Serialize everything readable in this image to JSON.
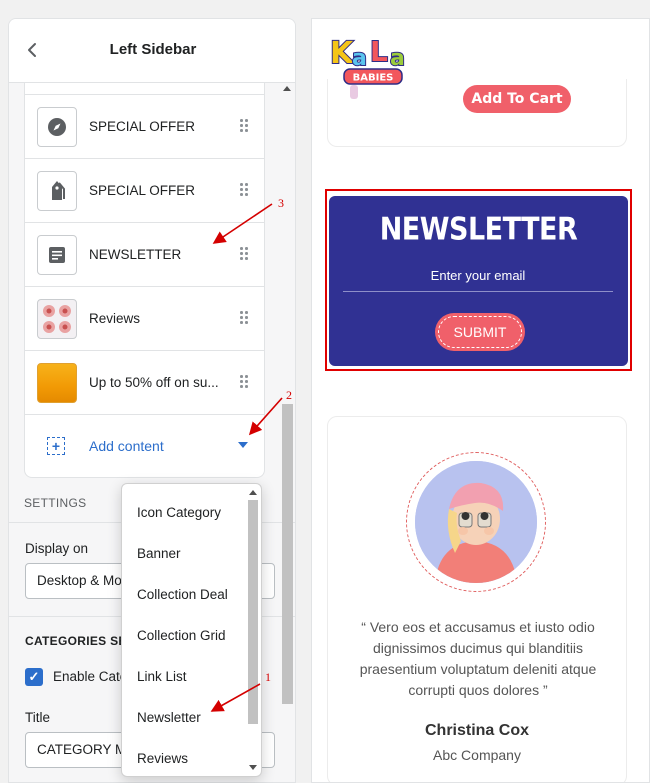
{
  "panel": {
    "title": "Left Sidebar",
    "blocks": [
      {
        "label": "SPECIAL OFFER",
        "icon": "compass-icon"
      },
      {
        "label": "SPECIAL OFFER",
        "icon": "tag-icon"
      },
      {
        "label": "NEWSLETTER",
        "icon": "document-icon"
      },
      {
        "label": "Reviews",
        "icon": "reviews-thumbnail"
      },
      {
        "label": "Up to 50% off on su...",
        "icon": "banner-thumbnail"
      }
    ],
    "add_content": "Add content",
    "settings_heading": "SETTINGS",
    "display_on_label": "Display on",
    "display_on_value": "Desktop & Mobile",
    "categories_heading": "CATEGORIES SETTINGS",
    "enable_label": "Enable Categories",
    "title_label": "Title",
    "title_value": "CATEGORY MENU"
  },
  "dropdown": {
    "items": [
      "Icon Category",
      "Banner",
      "Collection Deal",
      "Collection Grid",
      "Link List",
      "Newsletter",
      "Reviews"
    ]
  },
  "annotations": {
    "n1": "1",
    "n2": "2",
    "n3": "3",
    "color": "#d40000"
  },
  "preview": {
    "logo_top": "KaLa",
    "logo_bottom": "BABIES",
    "add_to_cart": "Add To Cart",
    "newsletter": {
      "title": "NEWSLETTER",
      "placeholder": "Enter your email",
      "submit": "SUBMIT",
      "bg_color": "#303193",
      "button_color": "#f0606a"
    },
    "testimonial": {
      "quote": "“ Vero eos et accusamus et iusto odio dignissimos ducimus qui blanditiis praesentium voluptatum deleniti atque corrupti quos dolores ”",
      "name": "Christina Cox",
      "company": "Abc Company"
    }
  },
  "colors": {
    "accent": "#2c6ecb",
    "highlight": "#e00000"
  }
}
